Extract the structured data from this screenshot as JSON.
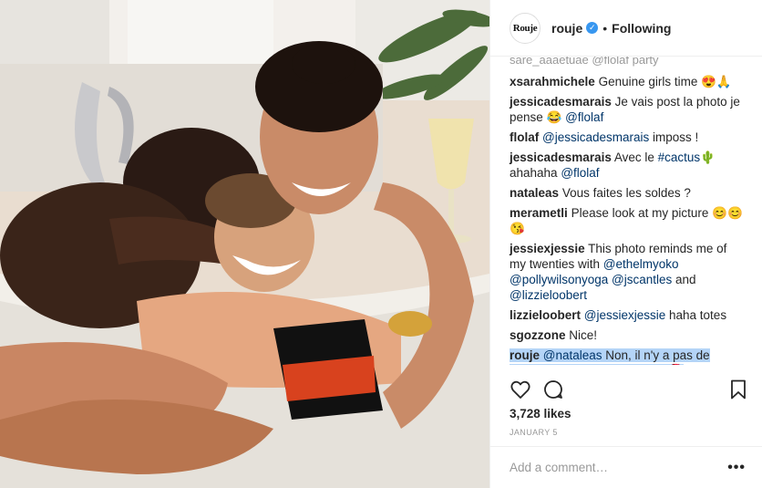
{
  "post": {
    "username": "rouje",
    "avatar_text": "Rouje",
    "follow_state": "Following",
    "separator": "•",
    "verified_icon": "verified-badge-icon"
  },
  "comments": [
    {
      "user": "xsarahmichele",
      "text": "Genuine girls time 😍🙏"
    },
    {
      "user": "jessicadesmarais",
      "text": "Je vais post la photo je pense 😂 @flolaf"
    },
    {
      "user": "flolaf",
      "text": "@jessicadesmarais imposs !"
    },
    {
      "user": "jessicadesmarais",
      "text": "Avec le #cactus🌵 ahahaha @flolaf"
    },
    {
      "user": "nataleas",
      "text": "Vous faites les soldes ?"
    },
    {
      "user": "merametli",
      "text": "Please look at my picture 😊😊😘"
    },
    {
      "user": "jessiexjessie",
      "text": "This photo reminds me of my twenties with @ethelmyoko @pollywilsonyoga @jscantles and @lizzieloobert"
    },
    {
      "user": "lizzieloobert",
      "text": "@jessiexjessie haha totes"
    },
    {
      "user": "sgozzone",
      "text": "Nice!"
    },
    {
      "user": "rouje",
      "text": "@nataleas Non, il n'y a pas de soldes prévues pour l'instant 🌹"
    }
  ],
  "cut_comment": "sare_aaaetuae @flolaf party",
  "likes": "3,728 likes",
  "date": "JANUARY 5",
  "add_comment_placeholder": "Add a comment…",
  "more_label": "•••",
  "icons": [
    "heart-icon",
    "comment-icon",
    "bookmark-icon"
  ],
  "colors": {
    "mention": "#003569",
    "highlight": "#b4d4f7",
    "verified": "#3897f0"
  }
}
